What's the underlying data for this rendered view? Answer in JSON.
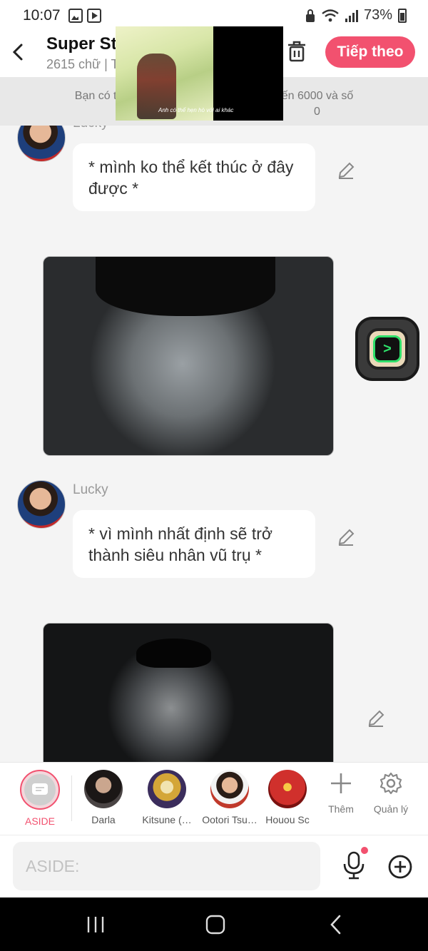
{
  "status_bar": {
    "time": "10:07",
    "battery_percent": "73%",
    "icons": [
      "gallery-icon",
      "media-play-icon",
      "lock-icon",
      "wifi-icon",
      "signal-icon",
      "battery-icon"
    ]
  },
  "header": {
    "title": "Super St",
    "subtitle": "2615 chữ | T"
  },
  "toolbar": {
    "continue_label": "Tiếp theo"
  },
  "info_bar": {
    "line1": "Bạn có thể đã                                    00 đến 6000 và số",
    "line2": "                                                                 0"
  },
  "pip": {
    "caption": "Anh có thể hẹn hò với ai khác"
  },
  "messages": [
    {
      "type": "text",
      "sender": "Lucky",
      "text": "* mình ko thể kết thúc ở đây được *"
    },
    {
      "type": "image",
      "description_icon": "photo-crying-man"
    },
    {
      "type": "text",
      "sender": "Lucky",
      "text": "* vì mình nhất định sẽ trở thành siêu nhân vũ trụ *"
    },
    {
      "type": "image",
      "description_icon": "photo-man-dark"
    }
  ],
  "characters": [
    {
      "label": "ASIDE",
      "active": true
    },
    {
      "label": "Darla",
      "color": "#3d3a3a"
    },
    {
      "label": "Kitsune (…",
      "color": "#c9a23b"
    },
    {
      "label": "Ootori Tsu…",
      "color": "#b9473a"
    },
    {
      "label": "Houou Sc",
      "color": "#d0302c"
    }
  ],
  "tools": {
    "add_label": "Thêm",
    "manage_label": "Quản lý"
  },
  "composer": {
    "placeholder": "ASIDE:"
  },
  "colors": {
    "accent": "#f2516f",
    "background": "#f4f4f4",
    "bubble": "#ffffff"
  }
}
